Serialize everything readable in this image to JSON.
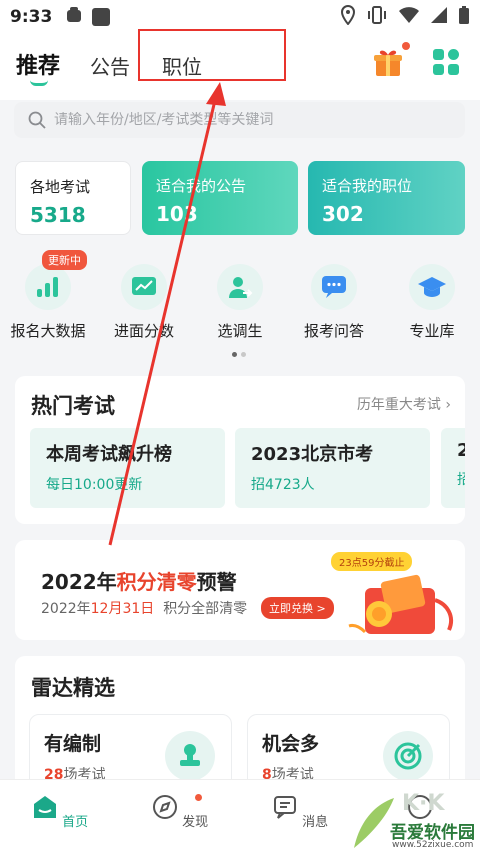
{
  "status_bar": {
    "time": "9:33"
  },
  "header": {
    "tabs": [
      {
        "label": "推荐"
      },
      {
        "label": "公告"
      },
      {
        "label": "职位"
      }
    ]
  },
  "search": {
    "placeholder": "请输入年份/地区/考试类型等关键词"
  },
  "stats": [
    {
      "label": "各地考试",
      "value": "5318"
    },
    {
      "label": "适合我的公告",
      "value": "103"
    },
    {
      "label": "适合我的职位",
      "value": "302"
    }
  ],
  "shortcuts": {
    "badge": "更新中",
    "items": [
      {
        "label": "报名大数据",
        "icon": "bar-chart-icon"
      },
      {
        "label": "进面分数",
        "icon": "line-chart-icon"
      },
      {
        "label": "选调生",
        "icon": "person-transfer-icon"
      },
      {
        "label": "报考问答",
        "icon": "chat-bubble-icon"
      },
      {
        "label": "专业库",
        "icon": "graduation-cap-icon"
      }
    ]
  },
  "hot_exams": {
    "title": "热门考试",
    "more": "历年重大考试",
    "cards": [
      {
        "title": "本周考试飙升榜",
        "sub": "每日10:00更新"
      },
      {
        "title": "2023北京市考",
        "sub": "招4723人"
      },
      {
        "title": "2",
        "sub": "招"
      }
    ]
  },
  "points_banner": {
    "title_prefix": "2022年",
    "title_highlight": "积分清零",
    "title_suffix": "预警",
    "sub_prefix": "2022年",
    "sub_date": "12月31日",
    "sub_suffix": "积分全部清零",
    "button": "立即兑换 >",
    "deadline": "23点59分截止"
  },
  "radar": {
    "title": "雷达精选",
    "cards": [
      {
        "title": "有编制",
        "num": "28",
        "unit": "场考试"
      },
      {
        "title": "机会多",
        "num": "8",
        "unit": "场考试"
      }
    ]
  },
  "bottom_nav": [
    {
      "label": "首页"
    },
    {
      "label": "发现"
    },
    {
      "label": "消息"
    },
    {
      "label": ""
    }
  ],
  "watermark": {
    "name": "吾爱软件园",
    "url": "www.52zixue.com"
  },
  "colors": {
    "accent": "#2cc49b",
    "annotation": "#e8342d",
    "alert": "#e8442d"
  }
}
